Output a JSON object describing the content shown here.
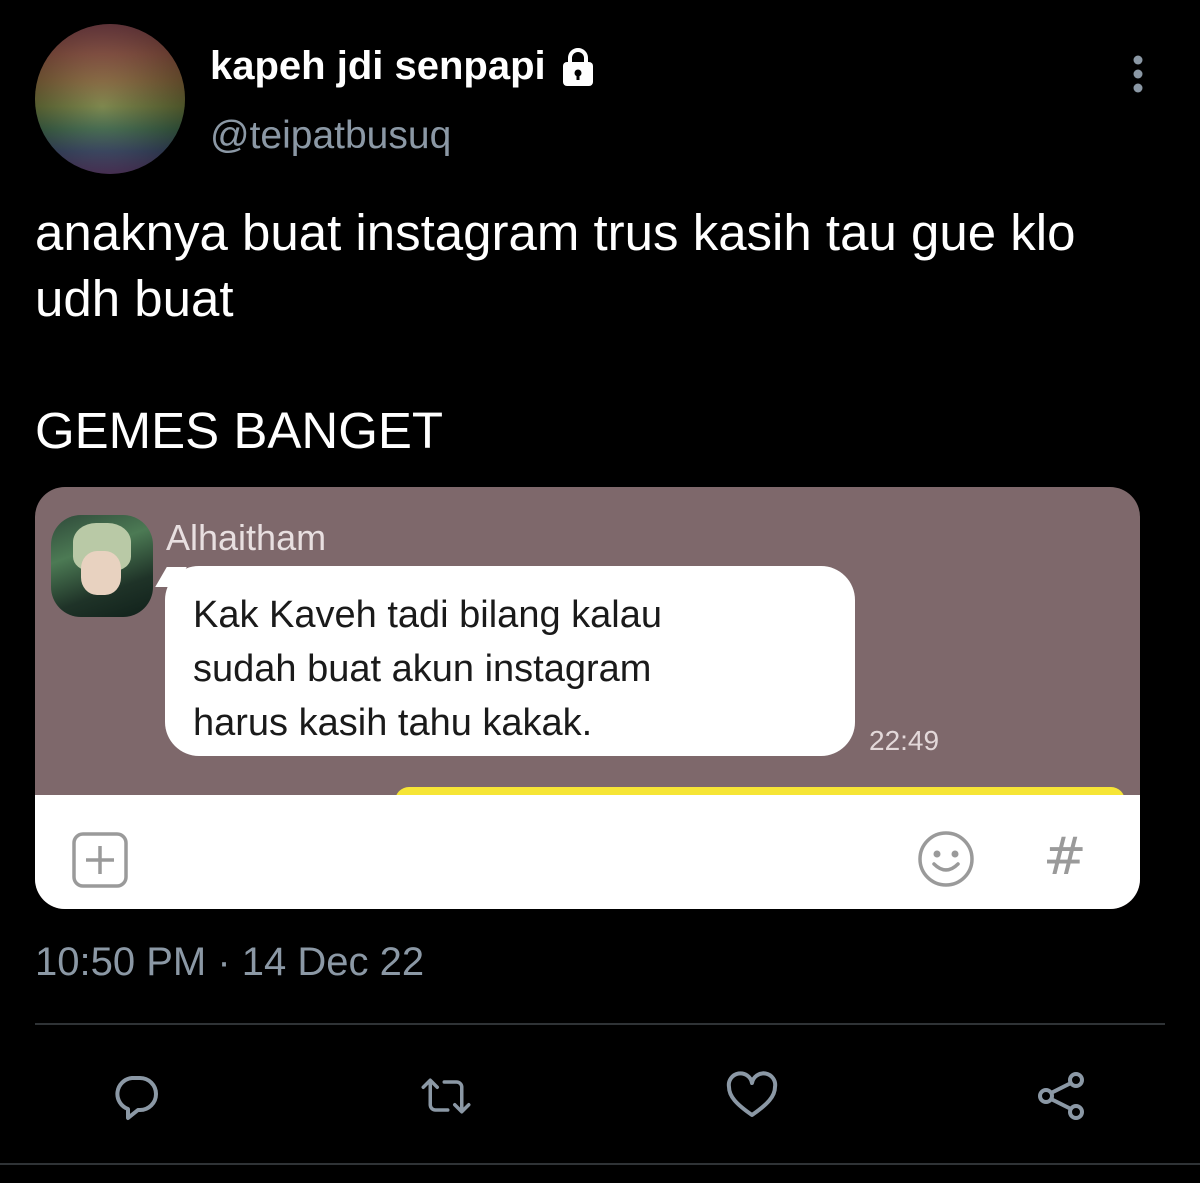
{
  "user": {
    "display_name": "kapeh jdi senpapi",
    "handle": "@teipatbusuq"
  },
  "tweet": {
    "paragraphs": [
      "anaknya buat instagram trus kasih tau gue klo udh buat",
      "GEMES BANGET"
    ],
    "timestamp": "10:50 PM · 14 Dec 22"
  },
  "media": {
    "sender_name": "Alhaitham",
    "message_lines": [
      "Kak Kaveh tadi bilang kalau",
      "sudah buat akun instagram",
      "harus kasih tahu kakak."
    ],
    "message_time": "22:49",
    "hash_symbol": "#"
  },
  "icons": {
    "lock": "lock-icon",
    "more": "more-vertical-icon",
    "reply": "reply-icon",
    "retweet": "retweet-icon",
    "like": "heart-icon",
    "share": "share-icon",
    "add": "plus-square-icon",
    "emoji": "emoji-icon"
  },
  "colors": {
    "background": "#000000",
    "text_primary": "#ffffff",
    "text_secondary": "#8b98a5",
    "chat_background": "#7e686b",
    "chat_bubble": "#ffffff",
    "chat_yellow": "#f6e536",
    "icon": "#8b98a5"
  }
}
